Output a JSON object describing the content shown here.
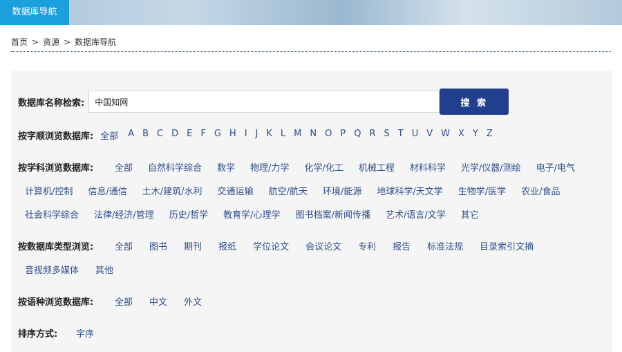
{
  "banner": {
    "tab_label": "数据库导航"
  },
  "breadcrumb": {
    "home": "首页",
    "resources": "资源",
    "current": "数据库导航",
    "sep": ">"
  },
  "search": {
    "label": "数据库名称检索:",
    "value": "中国知网",
    "button": "搜 索"
  },
  "alpha": {
    "label": "按字顺浏览数据库:",
    "items": [
      "全部",
      "A",
      "B",
      "C",
      "D",
      "E",
      "F",
      "G",
      "H",
      "I",
      "J",
      "K",
      "L",
      "M",
      "N",
      "O",
      "P",
      "Q",
      "R",
      "S",
      "T",
      "U",
      "V",
      "W",
      "X",
      "Y",
      "Z"
    ]
  },
  "subject": {
    "label": "按学科浏览数据库:",
    "items": [
      "全部",
      "自然科学综合",
      "数学",
      "物理/力学",
      "化学/化工",
      "机械工程",
      "材料科学",
      "光学/仪器/测绘",
      "电子/电气",
      "计算机/控制",
      "信息/通信",
      "土木/建筑/水利",
      "交通运输",
      "航空/航天",
      "环境/能源",
      "地球科学/天文学",
      "生物学/医学",
      "农业/食品",
      "社会科学综合",
      "法律/经济/管理",
      "历史/哲学",
      "教育学/心理学",
      "图书档案/新闻传播",
      "艺术/语言/文学",
      "其它"
    ]
  },
  "dbtype": {
    "label": "按数据库类型浏览:",
    "items": [
      "全部",
      "图书",
      "期刊",
      "报纸",
      "学位论文",
      "会议论文",
      "专利",
      "报告",
      "标准法规",
      "目录索引文摘",
      "音视频多媒体",
      "其他"
    ]
  },
  "language": {
    "label": "按语种浏览数据库:",
    "items": [
      "全部",
      "中文",
      "外文"
    ]
  },
  "sort": {
    "label": "排序方式:",
    "items": [
      "字序"
    ]
  },
  "colors": {
    "tab": "#1aa0dc",
    "button": "#213f8c",
    "link": "#2d4e8d",
    "panel": "#f5f5f5"
  }
}
